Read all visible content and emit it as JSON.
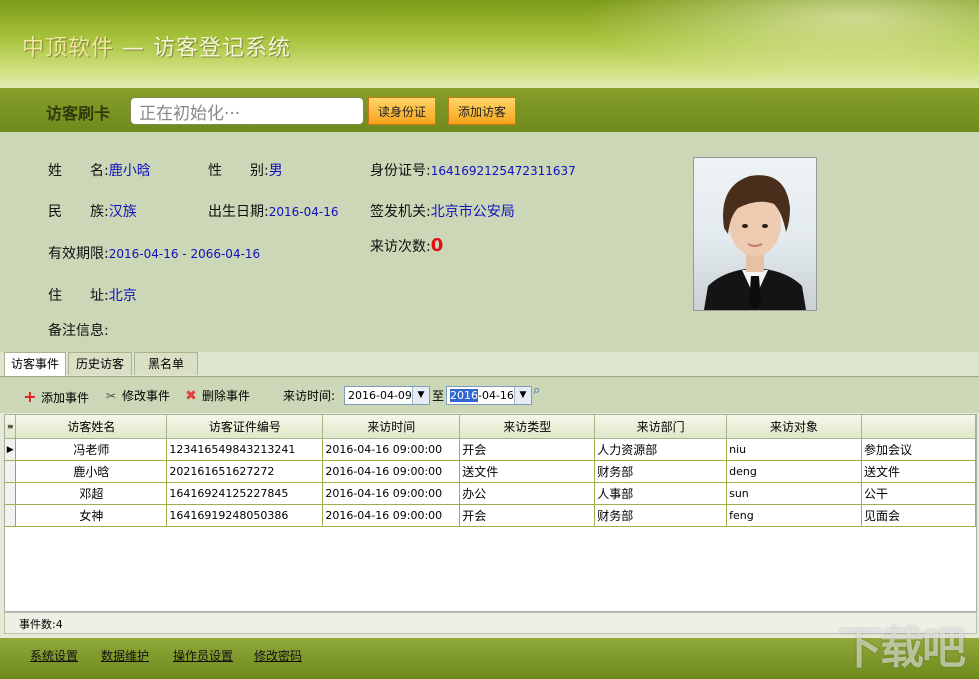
{
  "header": {
    "brand": "中顶软件",
    "separator": "—",
    "title": "访客登记系统"
  },
  "swipe": {
    "label": "访客刷卡",
    "input_value": "正在初始化···",
    "read_id_button": "读身份证",
    "add_visitor_button": "添加访客"
  },
  "visitor": {
    "name_label": "姓　　名:",
    "name": "鹿小晗",
    "gender_label": "性　　别:",
    "gender": "男",
    "id_label": "身份证号:",
    "id_number": "1641692125472311637",
    "ethnicity_label": "民　　族:",
    "ethnicity": "汉族",
    "birth_label": "出生日期:",
    "birth": "2016-04-16",
    "issuer_label": "签发机关:",
    "issuer": "北京市公安局",
    "validity_label": "有效期限:",
    "validity_start": "2016-04-16",
    "validity_sep": " - ",
    "validity_end": "2066-04-16",
    "visits_label": "来访次数:",
    "visits": "0",
    "address_label": "住　　址:",
    "address": "北京",
    "remark_label": "备注信息:"
  },
  "tabs": [
    "访客事件",
    "历史访客",
    "黑名单"
  ],
  "toolbar": {
    "add_event": "添加事件",
    "edit_event": "修改事件",
    "delete_event": "删除事件",
    "time_label": "来访时间:",
    "date_from": "2016-04-09",
    "to_label": "至",
    "date_to_selected": "2016",
    "date_to_rest": "-04-16"
  },
  "table": {
    "columns": [
      "访客姓名",
      "访客证件编号",
      "来访时间",
      "来访类型",
      "来访部门",
      "来访对象",
      ""
    ],
    "rows": [
      [
        "冯老师",
        "123416549843213241",
        "2016-04-16 09:00:00",
        "开会",
        "人力资源部",
        "niu",
        "参加会议"
      ],
      [
        "鹿小晗",
        "202161651627272",
        "2016-04-16 09:00:00",
        "送文件",
        "财务部",
        "deng",
        "送文件"
      ],
      [
        "邓超",
        "16416924125227845",
        "2016-04-16 09:00:00",
        "办公",
        "人事部",
        "sun",
        "公干"
      ],
      [
        "女神",
        "16416919248050386",
        "2016-04-16 09:00:00",
        "开会",
        "财务部",
        "feng",
        "见面会"
      ]
    ]
  },
  "status": {
    "count_label": "事件数:4"
  },
  "footer": {
    "links": [
      "系统设置",
      "数据维护",
      "操作员设置",
      "修改密码"
    ]
  },
  "watermark": "下载吧",
  "icons": {
    "add": "plus-icon",
    "edit": "tools-icon",
    "delete": "x-icon",
    "search": "magnifier-icon",
    "dropdown": "chevron-down-icon"
  },
  "colors": {
    "header": "#7c9a16",
    "panel": "#cbd7b6",
    "value_text": "#1010c0",
    "visit_count": "#e01010",
    "button": "#f6a21a"
  }
}
